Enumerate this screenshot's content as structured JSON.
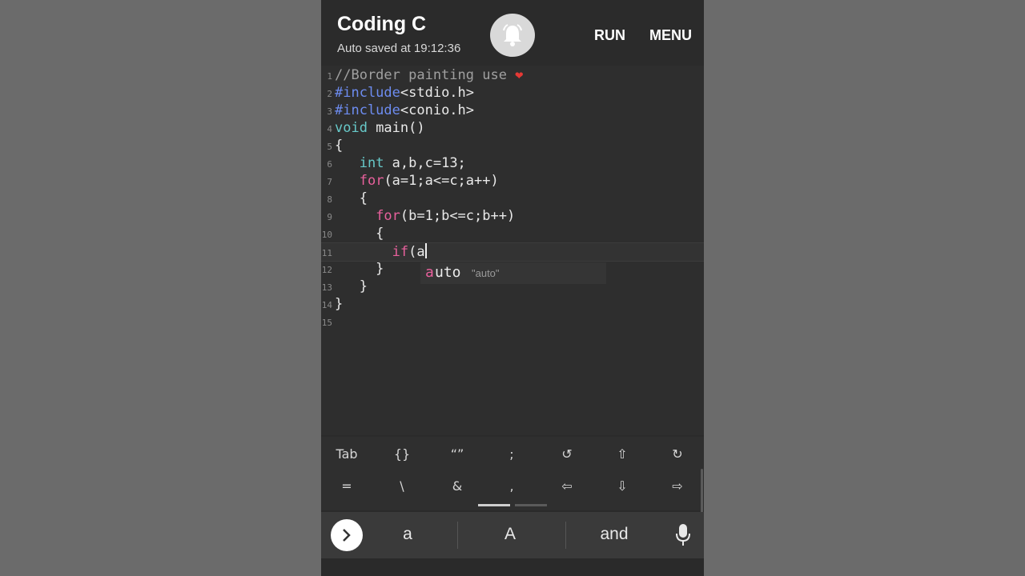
{
  "app": {
    "title": "Coding C",
    "autosave": "Auto saved at 19:12:36",
    "run_label": "RUN",
    "menu_label": "MENU"
  },
  "editor": {
    "lines": [
      {
        "n": "1",
        "segments": [
          {
            "t": "//Border painting use ",
            "c": "cmt"
          },
          {
            "t": "❤",
            "c": "heart"
          }
        ]
      },
      {
        "n": "2",
        "segments": [
          {
            "t": "#include",
            "c": "pp"
          },
          {
            "t": "<stdio.h>",
            "c": ""
          }
        ]
      },
      {
        "n": "3",
        "segments": [
          {
            "t": "#include",
            "c": "pp"
          },
          {
            "t": "<conio.h>",
            "c": ""
          }
        ]
      },
      {
        "n": "4",
        "segments": [
          {
            "t": "void",
            "c": "ty"
          },
          {
            "t": " main()",
            "c": ""
          }
        ]
      },
      {
        "n": "5",
        "segments": [
          {
            "t": "{",
            "c": ""
          }
        ]
      },
      {
        "n": "6",
        "segments": [
          {
            "t": "   ",
            "c": ""
          },
          {
            "t": "int",
            "c": "ty"
          },
          {
            "t": " a,b,c=13;",
            "c": ""
          }
        ]
      },
      {
        "n": "7",
        "segments": [
          {
            "t": "   ",
            "c": ""
          },
          {
            "t": "for",
            "c": "kw"
          },
          {
            "t": "(a=1;a<=c;a++)",
            "c": ""
          }
        ]
      },
      {
        "n": "8",
        "segments": [
          {
            "t": "   {",
            "c": ""
          }
        ]
      },
      {
        "n": "9",
        "segments": [
          {
            "t": "     ",
            "c": ""
          },
          {
            "t": "for",
            "c": "kw"
          },
          {
            "t": "(b=1;b<=c;b++)",
            "c": ""
          }
        ]
      },
      {
        "n": "10",
        "segments": [
          {
            "t": "     {",
            "c": ""
          }
        ]
      },
      {
        "n": "11",
        "segments": [
          {
            "t": "       ",
            "c": ""
          },
          {
            "t": "if",
            "c": "kw"
          },
          {
            "t": "(a",
            "c": ""
          }
        ]
      },
      {
        "n": "12",
        "segments": [
          {
            "t": "     }",
            "c": ""
          }
        ]
      },
      {
        "n": "13",
        "segments": [
          {
            "t": "   }",
            "c": ""
          }
        ]
      },
      {
        "n": "14",
        "segments": [
          {
            "t": "}",
            "c": ""
          }
        ]
      },
      {
        "n": "15",
        "segments": []
      }
    ],
    "current_line": 11,
    "autocomplete": {
      "typed": "a",
      "rest": "uto",
      "hint": "\"auto\""
    }
  },
  "symbols": {
    "row1": [
      "Tab",
      "{}",
      "“”",
      ";",
      "↺",
      "⇧",
      "↻"
    ],
    "row2": [
      "=",
      "\\",
      "&",
      ",",
      "⇦",
      "⇩",
      "⇨"
    ]
  },
  "keyboard": {
    "suggestions": [
      "a",
      "A",
      "and"
    ]
  },
  "colors": {
    "keyword": "#e8609c",
    "type": "#67c9c9",
    "preprocessor": "#6d8cf0",
    "comment": "#a0a0a0"
  }
}
